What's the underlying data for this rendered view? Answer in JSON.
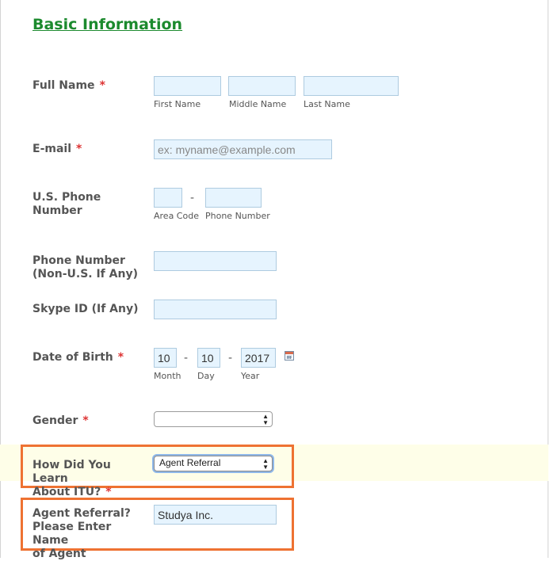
{
  "section_title": "Basic Information",
  "full_name": {
    "label": "Full Name",
    "required": "*",
    "first_sub": "First Name",
    "middle_sub": "Middle Name",
    "last_sub": "Last Name",
    "first_value": "",
    "middle_value": "",
    "last_value": ""
  },
  "email": {
    "label": "E-mail",
    "required": "*",
    "placeholder": "ex: myname@example.com",
    "value": ""
  },
  "us_phone": {
    "label": "U.S. Phone Number",
    "dash": "-",
    "area_sub": "Area Code",
    "phone_sub": "Phone Number",
    "area_value": "",
    "phone_value": ""
  },
  "non_us_phone": {
    "label_line1": "Phone Number",
    "label_line2": "(Non-U.S. If Any)",
    "value": ""
  },
  "skype": {
    "label": "Skype ID (If Any)",
    "value": ""
  },
  "dob": {
    "label": "Date of Birth",
    "required": "*",
    "month_value": "10",
    "day_value": "10",
    "year_value": "2017",
    "month_sub": "Month",
    "day_sub": "Day",
    "year_sub": "Year",
    "dash": "-",
    "calendar_icon": "calendar-icon"
  },
  "gender": {
    "label": "Gender",
    "required": "*",
    "selected": ""
  },
  "learn": {
    "label_line1": "How Did You Learn",
    "label_line2": "About ITU?",
    "required": "*",
    "selected": "Agent Referral"
  },
  "agent": {
    "label_line1": "Agent Referral?",
    "label_line2": "Please Enter Name",
    "label_line3": "of Agent",
    "value": "Studya Inc."
  },
  "colors": {
    "title_green": "#1c8a2e",
    "required_red": "#dd3333",
    "input_bg": "#e6f4fe",
    "highlight_orange": "#ee7232",
    "row_highlight": "#fefee8"
  }
}
